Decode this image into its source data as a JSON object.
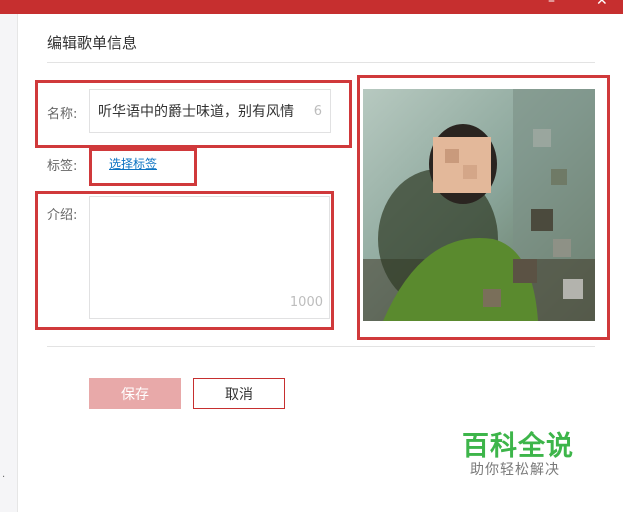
{
  "dialog": {
    "title": "编辑歌单信息",
    "name_label": "名称:",
    "name_value": "听华语中的爵士味道，别有风情",
    "name_counter": "6",
    "tags_label": "标签:",
    "tags_link": "选择标签",
    "intro_label": "介绍:",
    "intro_value": "",
    "intro_counter": "1000",
    "save_label": "保存",
    "cancel_label": "取消"
  },
  "watermark": {
    "logo_text": "百科全说",
    "slogan": "助你轻松解决"
  },
  "colors": {
    "brand_red": "#c62f2f",
    "annotation_red": "#d0393b",
    "link_blue": "#0c73c2",
    "watermark_green": "#3db54a"
  }
}
